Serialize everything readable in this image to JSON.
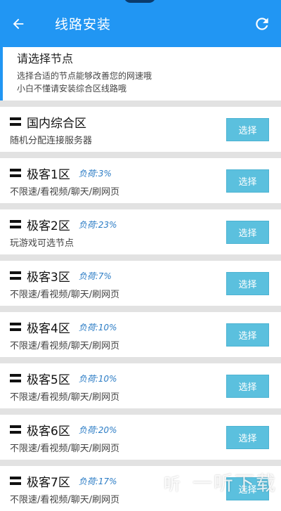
{
  "header": {
    "title": "线路安装",
    "back_icon": "arrow-left-icon",
    "refresh_icon": "refresh-icon",
    "bg_color": "#2196f3"
  },
  "info": {
    "heading": "请选择节点",
    "line1": "选择合适的节点能够改善您的网速哦",
    "line2": "小白不懂请安装综合区线路哦"
  },
  "nodes": [
    {
      "name": "国内综合区",
      "load": "",
      "desc": "随机分配连接服务器",
      "button": "选择"
    },
    {
      "name": "极客1区",
      "load": "负荷:3%",
      "desc": "不限速/看视频/聊天/刷网页",
      "button": "选择"
    },
    {
      "name": "极客2区",
      "load": "负荷:23%",
      "desc": "玩游戏可选节点",
      "button": "选择"
    },
    {
      "name": "极客3区",
      "load": "负荷:7%",
      "desc": "不限速/看视频/聊天/刷网页",
      "button": "选择"
    },
    {
      "name": "极客4区",
      "load": "负荷:10%",
      "desc": "不限速/看视频/聊天/刷网页",
      "button": "选择"
    },
    {
      "name": "极客5区",
      "load": "负荷:10%",
      "desc": "不限速/看视频/聊天/刷网页",
      "button": "选择"
    },
    {
      "name": "极客6区",
      "load": "负荷:20%",
      "desc": "不限速/看视频/聊天/刷网页",
      "button": "选择"
    },
    {
      "name": "极客7区",
      "load": "负荷:17%",
      "desc": "不限速/看视频/聊天/刷网页",
      "button": "选择"
    }
  ],
  "watermark": {
    "logo": "听",
    "text": "一听下载"
  }
}
